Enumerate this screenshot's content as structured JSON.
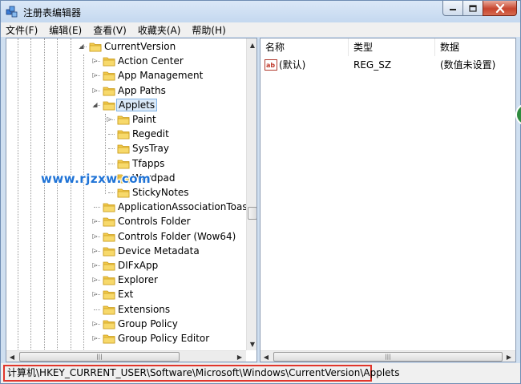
{
  "window": {
    "title": "注册表编辑器",
    "icon": "regedit-icon"
  },
  "menu": [
    {
      "label": "文件(F)"
    },
    {
      "label": "编辑(E)"
    },
    {
      "label": "查看(V)"
    },
    {
      "label": "收藏夹(A)"
    },
    {
      "label": "帮助(H)"
    }
  ],
  "tree": {
    "items": [
      {
        "label": "CurrentVersion",
        "depth": 0,
        "expander": "expanded"
      },
      {
        "label": "Action Center",
        "depth": 1,
        "expander": "collapsed"
      },
      {
        "label": "App Management",
        "depth": 1,
        "expander": "collapsed"
      },
      {
        "label": "App Paths",
        "depth": 1,
        "expander": "collapsed"
      },
      {
        "label": "Applets",
        "depth": 1,
        "expander": "expanded",
        "selected": true
      },
      {
        "label": "Paint",
        "depth": 2,
        "expander": "collapsed"
      },
      {
        "label": "Regedit",
        "depth": 2,
        "expander": "none"
      },
      {
        "label": "SysTray",
        "depth": 2,
        "expander": "none"
      },
      {
        "label": "Tfapps",
        "depth": 2,
        "expander": "none"
      },
      {
        "label": "Wordpad",
        "depth": 2,
        "expander": "collapsed"
      },
      {
        "label": "StickyNotes",
        "depth": 2,
        "expander": "none"
      },
      {
        "label": "ApplicationAssociationToasts",
        "depth": 1,
        "expander": "none"
      },
      {
        "label": "Controls Folder",
        "depth": 1,
        "expander": "collapsed"
      },
      {
        "label": "Controls Folder (Wow64)",
        "depth": 1,
        "expander": "collapsed"
      },
      {
        "label": "Device Metadata",
        "depth": 1,
        "expander": "collapsed"
      },
      {
        "label": "DIFxApp",
        "depth": 1,
        "expander": "collapsed"
      },
      {
        "label": "Explorer",
        "depth": 1,
        "expander": "collapsed"
      },
      {
        "label": "Ext",
        "depth": 1,
        "expander": "collapsed"
      },
      {
        "label": "Extensions",
        "depth": 1,
        "expander": "none"
      },
      {
        "label": "Group Policy",
        "depth": 1,
        "expander": "collapsed"
      },
      {
        "label": "Group Policy Editor",
        "depth": 1,
        "expander": "collapsed"
      }
    ]
  },
  "list": {
    "columns": [
      {
        "label": "名称"
      },
      {
        "label": "类型"
      },
      {
        "label": "数据"
      }
    ],
    "rows": [
      {
        "name": "(默认)",
        "type": "REG_SZ",
        "data": "(数值未设置)",
        "icon": "string-value-icon"
      }
    ]
  },
  "status": {
    "path": "计算机\\HKEY_CURRENT_USER\\Software\\Microsoft\\Windows\\CurrentVersion\\Applets"
  },
  "watermark": {
    "text": "www.rjzxw.com"
  },
  "colors": {
    "selection_bg": "#dbeaf9",
    "selection_border": "#7fb2e5",
    "status_highlight": "#e0352b",
    "watermark": "#1f73d6"
  }
}
